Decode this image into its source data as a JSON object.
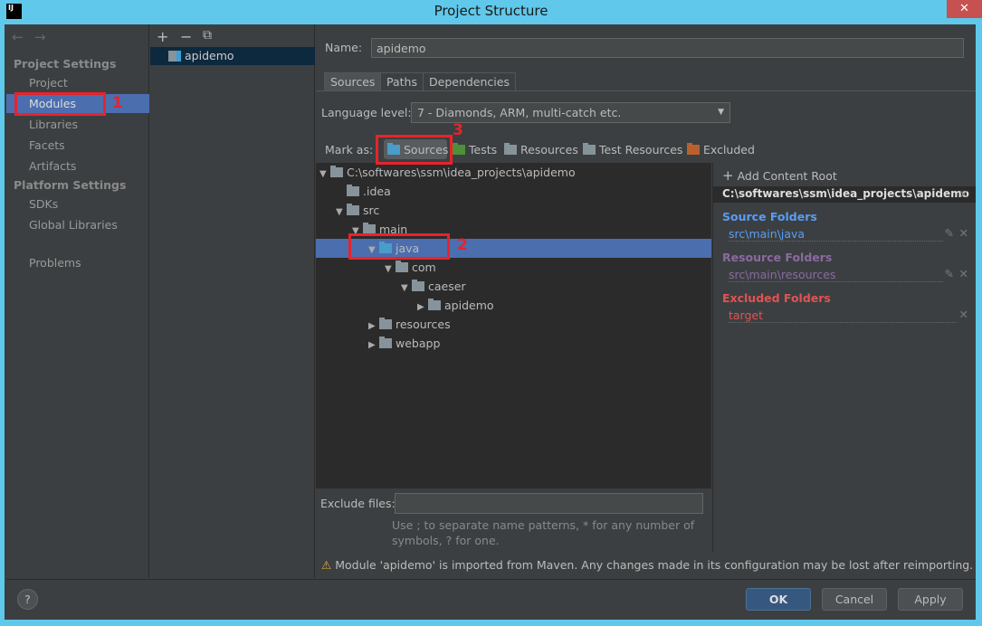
{
  "window": {
    "title": "Project Structure",
    "logo": "IJ",
    "close": "✕"
  },
  "sidebar": {
    "back": "←",
    "forward": "→",
    "project_settings": "Project Settings",
    "items1": [
      "Project",
      "Modules",
      "Libraries",
      "Facets",
      "Artifacts"
    ],
    "platform_settings": "Platform Settings",
    "items2": [
      "SDKs",
      "Global Libraries"
    ],
    "problems": "Problems",
    "selected": "Modules"
  },
  "modules": {
    "toolbar": [
      "+",
      "−",
      "⧉"
    ],
    "items": [
      "apidemo"
    ]
  },
  "main": {
    "name_label": "Name:",
    "name_value": "apidemo",
    "tabs": [
      "Sources",
      "Paths",
      "Dependencies"
    ],
    "active_tab": "Sources",
    "language_label": "Language level:",
    "language_value": "7 - Diamonds, ARM, multi-catch etc.",
    "mark_as": "Mark as:",
    "mark_buttons": [
      "Sources",
      "Tests",
      "Resources",
      "Test Resources",
      "Excluded"
    ],
    "tree": [
      {
        "label": "C:\\softwares\\ssm\\idea_projects\\apidemo",
        "depth": 0,
        "expanded": true
      },
      {
        "label": ".idea",
        "depth": 1,
        "expanded": null
      },
      {
        "label": "src",
        "depth": 1,
        "expanded": true
      },
      {
        "label": "main",
        "depth": 2,
        "expanded": true
      },
      {
        "label": "java",
        "depth": 3,
        "expanded": true,
        "selected": true,
        "type": "source"
      },
      {
        "label": "com",
        "depth": 4,
        "expanded": true,
        "type": "package"
      },
      {
        "label": "caeser",
        "depth": 5,
        "expanded": true,
        "type": "package"
      },
      {
        "label": "apidemo",
        "depth": 6,
        "expanded": false,
        "type": "package"
      },
      {
        "label": "resources",
        "depth": 3,
        "expanded": false,
        "type": "resource"
      },
      {
        "label": "webapp",
        "depth": 3,
        "expanded": false
      }
    ],
    "exclude_label": "Exclude files:",
    "exclude_value": "",
    "exclude_hint1": "Use ; to separate name patterns, * for any number of",
    "exclude_hint2": "symbols, ? for one.",
    "warning": "Module 'apidemo' is imported from Maven. Any changes made in its configuration may be lost after reimporting."
  },
  "roots": {
    "add": "Add Content Root",
    "root": "C:\\softwares\\ssm\\idea_projects\\apidemo",
    "source_title": "Source Folders",
    "source": "src\\main\\java",
    "resource_title": "Resource Folders",
    "resource": "src\\main\\resources",
    "excluded_title": "Excluded Folders",
    "excluded": "target"
  },
  "footer": {
    "help": "?",
    "ok": "OK",
    "cancel": "Cancel",
    "apply": "Apply"
  },
  "annotations": [
    "1",
    "2",
    "3"
  ],
  "colors": {
    "source": "#589df6",
    "resource": "#8a6aa0",
    "excluded": "#e35252",
    "selection": "#4b6eaf"
  }
}
